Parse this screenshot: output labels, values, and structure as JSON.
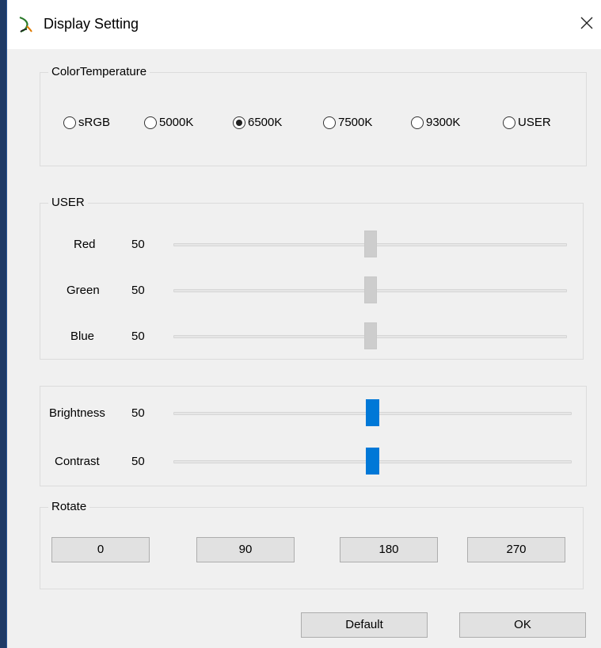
{
  "window": {
    "title": "Display Setting"
  },
  "color_temperature": {
    "label": "ColorTemperature",
    "options": [
      "sRGB",
      "5000K",
      "6500K",
      "7500K",
      "9300K",
      "USER"
    ],
    "selected": "6500K"
  },
  "user": {
    "label": "USER",
    "red": {
      "label": "Red",
      "value": "50",
      "level": 0.5
    },
    "green": {
      "label": "Green",
      "value": "50",
      "level": 0.5
    },
    "blue": {
      "label": "Blue",
      "value": "50",
      "level": 0.5
    }
  },
  "picture": {
    "brightness": {
      "label": "Brightness",
      "value": "50",
      "level": 0.5
    },
    "contrast": {
      "label": "Contrast",
      "value": "50",
      "level": 0.5
    }
  },
  "rotate": {
    "label": "Rotate",
    "buttons": [
      "0",
      "90",
      "180",
      "270"
    ]
  },
  "footer": {
    "default_label": "Default",
    "ok_label": "OK"
  },
  "colors": {
    "accent_thumb": "#0078d7",
    "gray_thumb": "#cdcdcd"
  }
}
